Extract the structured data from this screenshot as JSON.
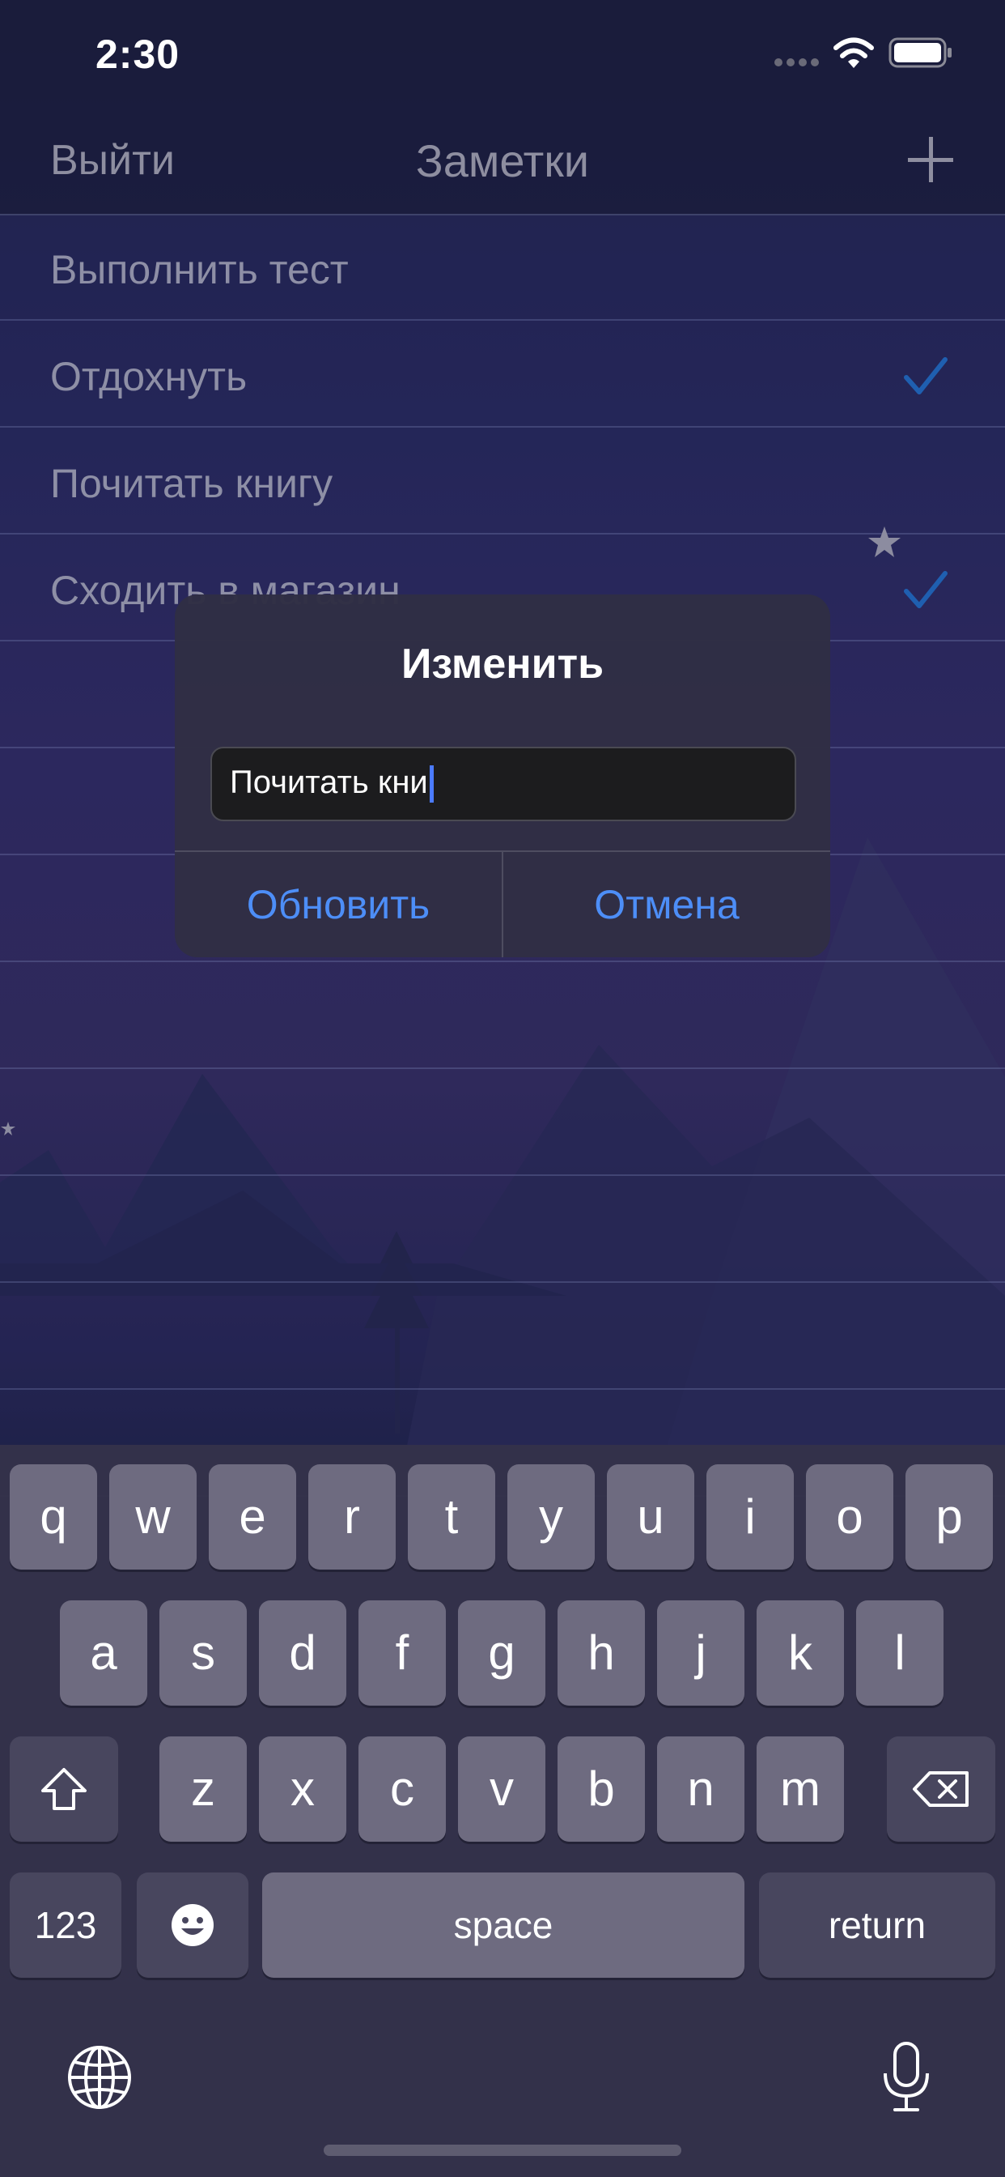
{
  "status_bar": {
    "time": "2:30"
  },
  "nav": {
    "left_label": "Выйти",
    "title": "Заметки",
    "add_icon": "plus-icon"
  },
  "notes": [
    {
      "label": "Выполнить тест",
      "checked": false
    },
    {
      "label": "Отдохнуть",
      "checked": true
    },
    {
      "label": "Почитать книгу",
      "checked": false
    },
    {
      "label": "Сходить в магазин",
      "checked": true
    }
  ],
  "alert": {
    "title": "Изменить",
    "input_value": "Почитать кни",
    "primary_label": "Обновить",
    "cancel_label": "Отмена"
  },
  "keyboard": {
    "row1": [
      "q",
      "w",
      "e",
      "r",
      "t",
      "y",
      "u",
      "i",
      "o",
      "p"
    ],
    "row2": [
      "a",
      "s",
      "d",
      "f",
      "g",
      "h",
      "j",
      "k",
      "l"
    ],
    "row3": [
      "z",
      "x",
      "c",
      "v",
      "b",
      "n",
      "m"
    ],
    "numbers_label": "123",
    "space_label": "space",
    "return_label": "return",
    "icons": [
      "shift-icon",
      "backspace-icon",
      "emoji-icon",
      "globe-icon",
      "microphone-icon"
    ]
  },
  "colors": {
    "accent": "#4d8ef7",
    "check": "#1f5fb0",
    "caret": "#4b7bff"
  }
}
